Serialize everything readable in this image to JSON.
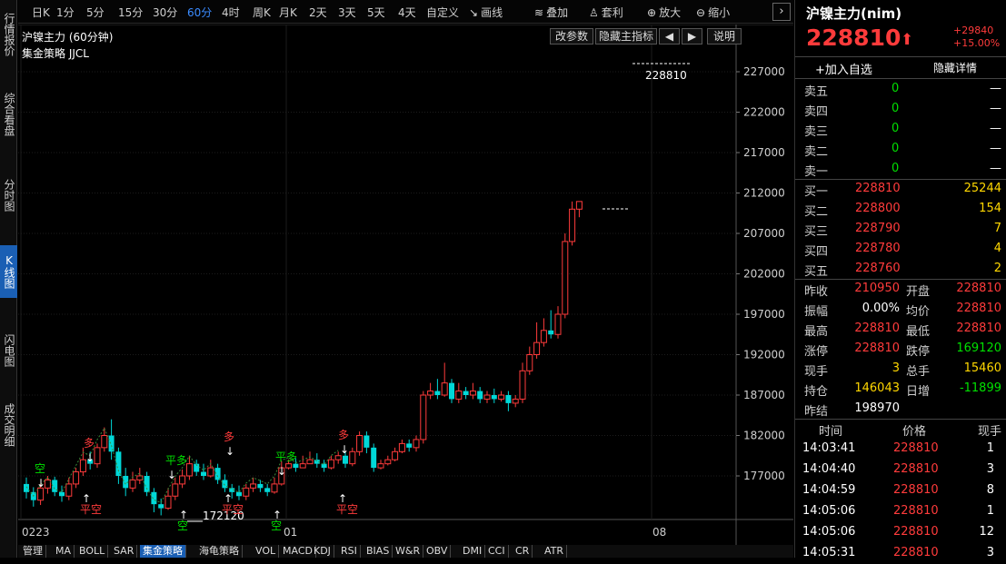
{
  "left_tabs": [
    {
      "label": "行情报价"
    },
    {
      "label": "综合看盘"
    },
    {
      "label": "分时图"
    },
    {
      "label": "K线图",
      "active": true
    },
    {
      "label": "闪电图"
    },
    {
      "label": "成交明细"
    }
  ],
  "topbar": {
    "items": [
      "日K",
      "1分",
      "5分",
      "15分",
      "30分",
      "60分",
      "4时",
      "周K",
      "月K",
      "2天",
      "3天",
      "5天",
      "4天",
      "自定义",
      "画线",
      "叠加",
      "套利",
      "放大",
      "缩小"
    ],
    "active": "60分"
  },
  "chart": {
    "title": "沪镍主力 (60分钟)",
    "indicator_label": "集金策略 JJCL",
    "buttons": [
      "改参数",
      "隐藏主指标",
      "◀",
      "▶",
      "说明"
    ],
    "y_ticks": [
      "227000",
      "222000",
      "217000",
      "212000",
      "207000",
      "202000",
      "197000",
      "192000",
      "187000",
      "182000",
      "177000"
    ],
    "x_ticks": [
      "0223",
      "01",
      "08"
    ],
    "last_price_label": "228810",
    "min_label": "172120",
    "signals": [
      {
        "text": "空",
        "color": "#00e000"
      },
      {
        "text": "平空",
        "color": "#ff3b3b"
      },
      {
        "text": "多",
        "color": "#ff3b3b"
      },
      {
        "text": "平多",
        "color": "#00e000"
      },
      {
        "text": "空",
        "color": "#00e000"
      },
      {
        "text": "多",
        "color": "#ff3b3b"
      },
      {
        "text": "平空",
        "color": "#ff3b3b"
      },
      {
        "text": "平多",
        "color": "#00e000"
      },
      {
        "text": "空",
        "color": "#00e000"
      },
      {
        "text": "多",
        "color": "#ff3b3b"
      },
      {
        "text": "平空",
        "color": "#ff3b3b"
      }
    ]
  },
  "chart_data": {
    "type": "candlestick",
    "candles": [
      [
        176000,
        175000,
        176800,
        174200
      ],
      [
        175000,
        174000,
        175600,
        173200
      ],
      [
        174000,
        175500,
        176000,
        173400
      ],
      [
        175500,
        176500,
        177000,
        174800
      ],
      [
        176500,
        175000,
        176900,
        174500
      ],
      [
        175000,
        174500,
        175800,
        173800
      ],
      [
        174500,
        176000,
        176800,
        174000
      ],
      [
        176000,
        177500,
        178000,
        175500
      ],
      [
        177500,
        179000,
        180500,
        177000
      ],
      [
        179000,
        178500,
        180000,
        177800
      ],
      [
        178500,
        180500,
        181000,
        178000
      ],
      [
        180500,
        182000,
        183000,
        180000
      ],
      [
        182000,
        180000,
        184000,
        179000
      ],
      [
        180000,
        177000,
        180500,
        176000
      ],
      [
        177000,
        175500,
        178000,
        174500
      ],
      [
        175500,
        176500,
        177500,
        175000
      ],
      [
        176500,
        177000,
        178000,
        176000
      ],
      [
        177000,
        175000,
        177500,
        174500
      ],
      [
        175000,
        173500,
        175500,
        172500
      ],
      [
        173500,
        173000,
        174200,
        172120
      ],
      [
        173000,
        174500,
        175500,
        172800
      ],
      [
        174500,
        176000,
        176800,
        174000
      ],
      [
        176000,
        177000,
        177800,
        175500
      ],
      [
        177000,
        178500,
        179500,
        176500
      ],
      [
        178500,
        177500,
        179000,
        177000
      ],
      [
        177500,
        177000,
        178500,
        176500
      ],
      [
        177000,
        178000,
        179000,
        176800
      ],
      [
        178000,
        176500,
        178500,
        176000
      ],
      [
        176500,
        175500,
        177200,
        175000
      ],
      [
        175500,
        175000,
        176000,
        174200
      ],
      [
        175000,
        174500,
        175800,
        174000
      ],
      [
        174500,
        175500,
        176000,
        174000
      ],
      [
        175500,
        176000,
        176800,
        175000
      ],
      [
        176000,
        175500,
        176500,
        175000
      ],
      [
        175500,
        175000,
        176000,
        174500
      ],
      [
        175000,
        176000,
        176800,
        174800
      ],
      [
        176000,
        178000,
        178800,
        175800
      ],
      [
        178000,
        178500,
        179000,
        177800
      ],
      [
        178500,
        178000,
        179200,
        177500
      ],
      [
        178000,
        178500,
        179500,
        178000
      ],
      [
        178500,
        179000,
        180000,
        178500
      ],
      [
        179000,
        178500,
        179800,
        178000
      ],
      [
        178500,
        178000,
        179000,
        177500
      ],
      [
        178000,
        179000,
        179500,
        177800
      ],
      [
        179000,
        179500,
        180000,
        178500
      ],
      [
        179500,
        178500,
        180000,
        178000
      ],
      [
        178500,
        180000,
        180500,
        178200
      ],
      [
        180000,
        182000,
        182500,
        179500
      ],
      [
        182000,
        180500,
        182500,
        179800
      ],
      [
        180500,
        178000,
        181000,
        177500
      ],
      [
        178000,
        178500,
        179000,
        177800
      ],
      [
        178500,
        179000,
        179500,
        178300
      ],
      [
        179000,
        180000,
        180500,
        178800
      ],
      [
        180000,
        181000,
        181500,
        179800
      ],
      [
        181000,
        180500,
        181500,
        180000
      ],
      [
        180500,
        181500,
        182000,
        180000
      ],
      [
        181500,
        187000,
        187500,
        181000
      ],
      [
        187000,
        187500,
        188500,
        186500
      ],
      [
        187500,
        187000,
        189000,
        186500
      ],
      [
        187000,
        188500,
        191000,
        186800
      ],
      [
        188500,
        186500,
        189000,
        186000
      ],
      [
        186500,
        187500,
        188500,
        186000
      ],
      [
        187500,
        187000,
        188000,
        186500
      ],
      [
        187000,
        187500,
        188500,
        186500
      ],
      [
        187500,
        186500,
        188000,
        186000
      ],
      [
        186500,
        187000,
        187500,
        186000
      ],
      [
        187000,
        186500,
        187800,
        186000
      ],
      [
        186500,
        187000,
        187500,
        186200
      ],
      [
        187000,
        186000,
        187500,
        185000
      ],
      [
        186000,
        186500,
        187000,
        185500
      ],
      [
        186500,
        190000,
        191000,
        186000
      ],
      [
        190000,
        192000,
        193000,
        189500
      ],
      [
        192000,
        193500,
        196000,
        191500
      ],
      [
        193500,
        195000,
        196500,
        193000
      ],
      [
        195000,
        194500,
        197500,
        194000
      ],
      [
        194500,
        197000,
        198000,
        194000
      ],
      [
        197000,
        206000,
        207000,
        196500
      ],
      [
        206000,
        210000,
        210950,
        205500
      ],
      [
        210000,
        210950,
        210950,
        209000
      ]
    ],
    "last_price": 228810,
    "y_min_label": 172120
  },
  "quote": {
    "name": "沪镍主力(nim)",
    "price": "228810",
    "arrow": "⬆",
    "change": "+29840",
    "change_pct": "+15.00%",
    "add_watch": "+加入自选",
    "detail": "隐藏详情",
    "asks": [
      {
        "label": "卖五",
        "price": "0",
        "vol": "—"
      },
      {
        "label": "卖四",
        "price": "0",
        "vol": "—"
      },
      {
        "label": "卖三",
        "price": "0",
        "vol": "—"
      },
      {
        "label": "卖二",
        "price": "0",
        "vol": "—"
      },
      {
        "label": "卖一",
        "price": "0",
        "vol": "—"
      }
    ],
    "bids": [
      {
        "label": "买一",
        "price": "228810",
        "vol": "25244"
      },
      {
        "label": "买二",
        "price": "228800",
        "vol": "154"
      },
      {
        "label": "买三",
        "price": "228790",
        "vol": "7"
      },
      {
        "label": "买四",
        "price": "228780",
        "vol": "4"
      },
      {
        "label": "买五",
        "price": "228760",
        "vol": "2"
      }
    ],
    "stats": [
      {
        "l1": "昨收",
        "v1": "210950",
        "c1": "red",
        "l2": "开盘",
        "v2": "228810",
        "c2": "red"
      },
      {
        "l1": "振幅",
        "v1": "0.00%",
        "c1": "white",
        "l2": "均价",
        "v2": "228810",
        "c2": "red"
      },
      {
        "l1": "最高",
        "v1": "228810",
        "c1": "red",
        "l2": "最低",
        "v2": "228810",
        "c2": "red"
      },
      {
        "l1": "涨停",
        "v1": "228810",
        "c1": "red",
        "l2": "跌停",
        "v2": "169120",
        "c2": "green"
      },
      {
        "l1": "现手",
        "v1": "3",
        "c1": "yellow",
        "l2": "总手",
        "v2": "15460",
        "c2": "yellow"
      },
      {
        "l1": "持仓",
        "v1": "146043",
        "c1": "yellow",
        "l2": "日增",
        "v2": "-11899",
        "c2": "green"
      },
      {
        "l1": "昨结",
        "v1": "198970",
        "c1": "white",
        "l2": "",
        "v2": "",
        "c2": "white"
      }
    ],
    "ticks_header": [
      "时间",
      "价格",
      "现手"
    ],
    "ticks": [
      {
        "time": "14:03:41",
        "price": "228810",
        "vol": "1"
      },
      {
        "time": "14:04:40",
        "price": "228810",
        "vol": "3"
      },
      {
        "time": "14:04:59",
        "price": "228810",
        "vol": "8"
      },
      {
        "time": "14:05:06",
        "price": "228810",
        "vol": "1"
      },
      {
        "time": "14:05:06",
        "price": "228810",
        "vol": "12"
      },
      {
        "time": "14:05:31",
        "price": "228810",
        "vol": "3"
      }
    ]
  },
  "bottombar": {
    "items": [
      "管理",
      "MA",
      "BOLL",
      "SAR",
      "集金策略",
      "海龟策略",
      "VOL",
      "MACD",
      "KDJ",
      "RSI",
      "BIAS",
      "W&R",
      "OBV",
      "DMI",
      "CCI",
      "CR",
      "ATR"
    ],
    "active": "集金策略"
  }
}
